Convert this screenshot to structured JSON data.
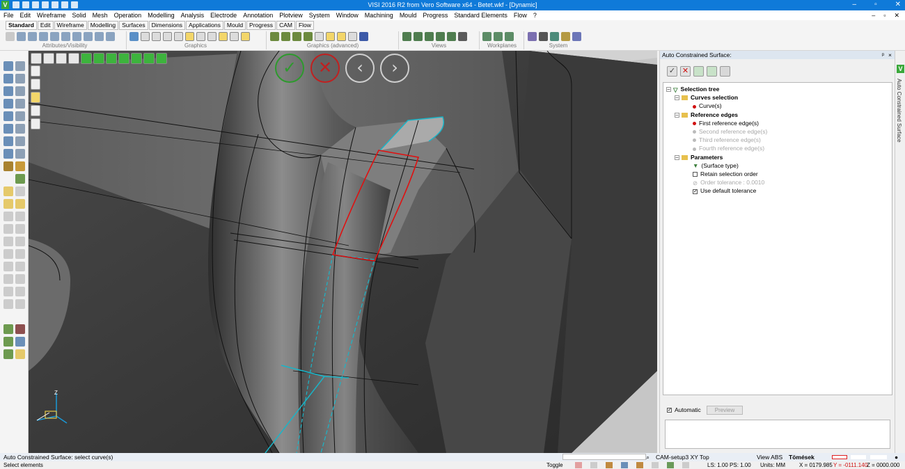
{
  "window": {
    "title": "VISI 2016 R2 from Vero Software x64 - Betet.wkf - [Dynamic]",
    "app_letter": "V",
    "buttons": [
      "–",
      "▫",
      "✕"
    ]
  },
  "menu": {
    "items": [
      "File",
      "Edit",
      "Wireframe",
      "Solid",
      "Mesh",
      "Operation",
      "Modelling",
      "Analysis",
      "Electrode",
      "Annotation",
      "Plotview",
      "System",
      "Window",
      "Machining",
      "Mould",
      "Progress",
      "Standard Elements",
      "Flow",
      "?"
    ],
    "right": [
      "–",
      "▫",
      "✕"
    ]
  },
  "toolbar": {
    "tabs": [
      "Standard",
      "Edit",
      "Wireframe",
      "Modelling",
      "Surfaces",
      "Dimensions",
      "Applications",
      "Mould",
      "Progress",
      "CAM",
      "Flow"
    ],
    "groups": [
      "Attributes/Visibility",
      "Graphics",
      "Graphics (advanced)",
      "Views",
      "Workplanes",
      "System"
    ]
  },
  "viewport": {
    "nav_buttons": [
      "✓",
      "✕",
      "‹",
      "›"
    ],
    "axis_label": "Z"
  },
  "panel": {
    "title": "Auto Constrained Surface:",
    "pin_symbols": [
      "ᵖ",
      "×"
    ],
    "tree": {
      "root": "Selection tree",
      "curves_selection": "Curves selection",
      "curves": "Curve(s)",
      "reference_edges": "Reference edges",
      "first_edge": "First reference edge(s)",
      "second_edge": "Second reference edge(s)",
      "third_edge": "Third reference edge(s)",
      "fourth_edge": "Fourth reference edge(s)",
      "parameters": "Parameters",
      "surface_type": "(Surface type)",
      "retain_order": "Retain selection order",
      "order_tolerance": "Order tolerance : 0.0010",
      "use_default_tolerance": "Use default tolerance"
    },
    "automatic_label": "Automatic",
    "preview_label": "Preview",
    "side_tab": "Auto Constrained Surface",
    "side_tab_letter": "V"
  },
  "status": {
    "prompt": "Auto Constrained Surface: select curve(s)",
    "sub_prompt": "Select elements",
    "workplane": "CAM-setup3 XY Top",
    "view": "View ABS",
    "mode": "Tömések",
    "toggle": "Toggle",
    "line_style": "LS: 1.00 PS: 1.00",
    "units": "Units: MM",
    "coord_x": "X = 0179.985",
    "coord_y": "Y = -0111.140",
    "coord_z": "Z = 0000.000"
  },
  "colors": {
    "accent": "#0f7ad9",
    "selection_red": "#e01010",
    "selection_cyan": "#19b5c8",
    "ok_green": "#2d9a2d"
  }
}
